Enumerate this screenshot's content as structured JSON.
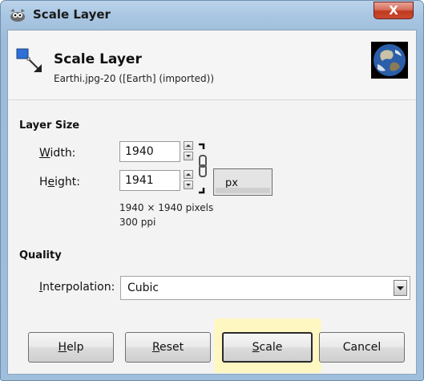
{
  "window": {
    "title": "Scale Layer",
    "close_glyph": "X"
  },
  "header": {
    "title": "Scale Layer",
    "subtitle": "Earthi.jpg-20 ([Earth] (imported))",
    "icon": "scale-layer-icon",
    "thumbnail": "earth-thumbnail"
  },
  "layer_size": {
    "section_label": "Layer Size",
    "width_label_pre": "",
    "width_label_u": "W",
    "width_label_post": "idth:",
    "width_value": "1940",
    "height_label_pre": "H",
    "height_label_u": "e",
    "height_label_post": "ight:",
    "height_value": "1941",
    "unit": "px",
    "pixels_info": "1940 × 1940 pixels",
    "ppi_info": "300 ppi",
    "chain_icon": "chain-link-icon"
  },
  "quality": {
    "section_label": "Quality",
    "interp_label_u": "I",
    "interp_label_post": "nterpolation:",
    "interp_value": "Cubic"
  },
  "buttons": {
    "help_u": "H",
    "help_post": "elp",
    "reset_u": "R",
    "reset_post": "eset",
    "scale_u": "S",
    "scale_post": "cale",
    "cancel": "Cancel"
  },
  "colors": {
    "frame": "#a9c6e2",
    "close": "#c0391f",
    "client": "#f3f3f3",
    "default_glow": "#fff7c2"
  }
}
